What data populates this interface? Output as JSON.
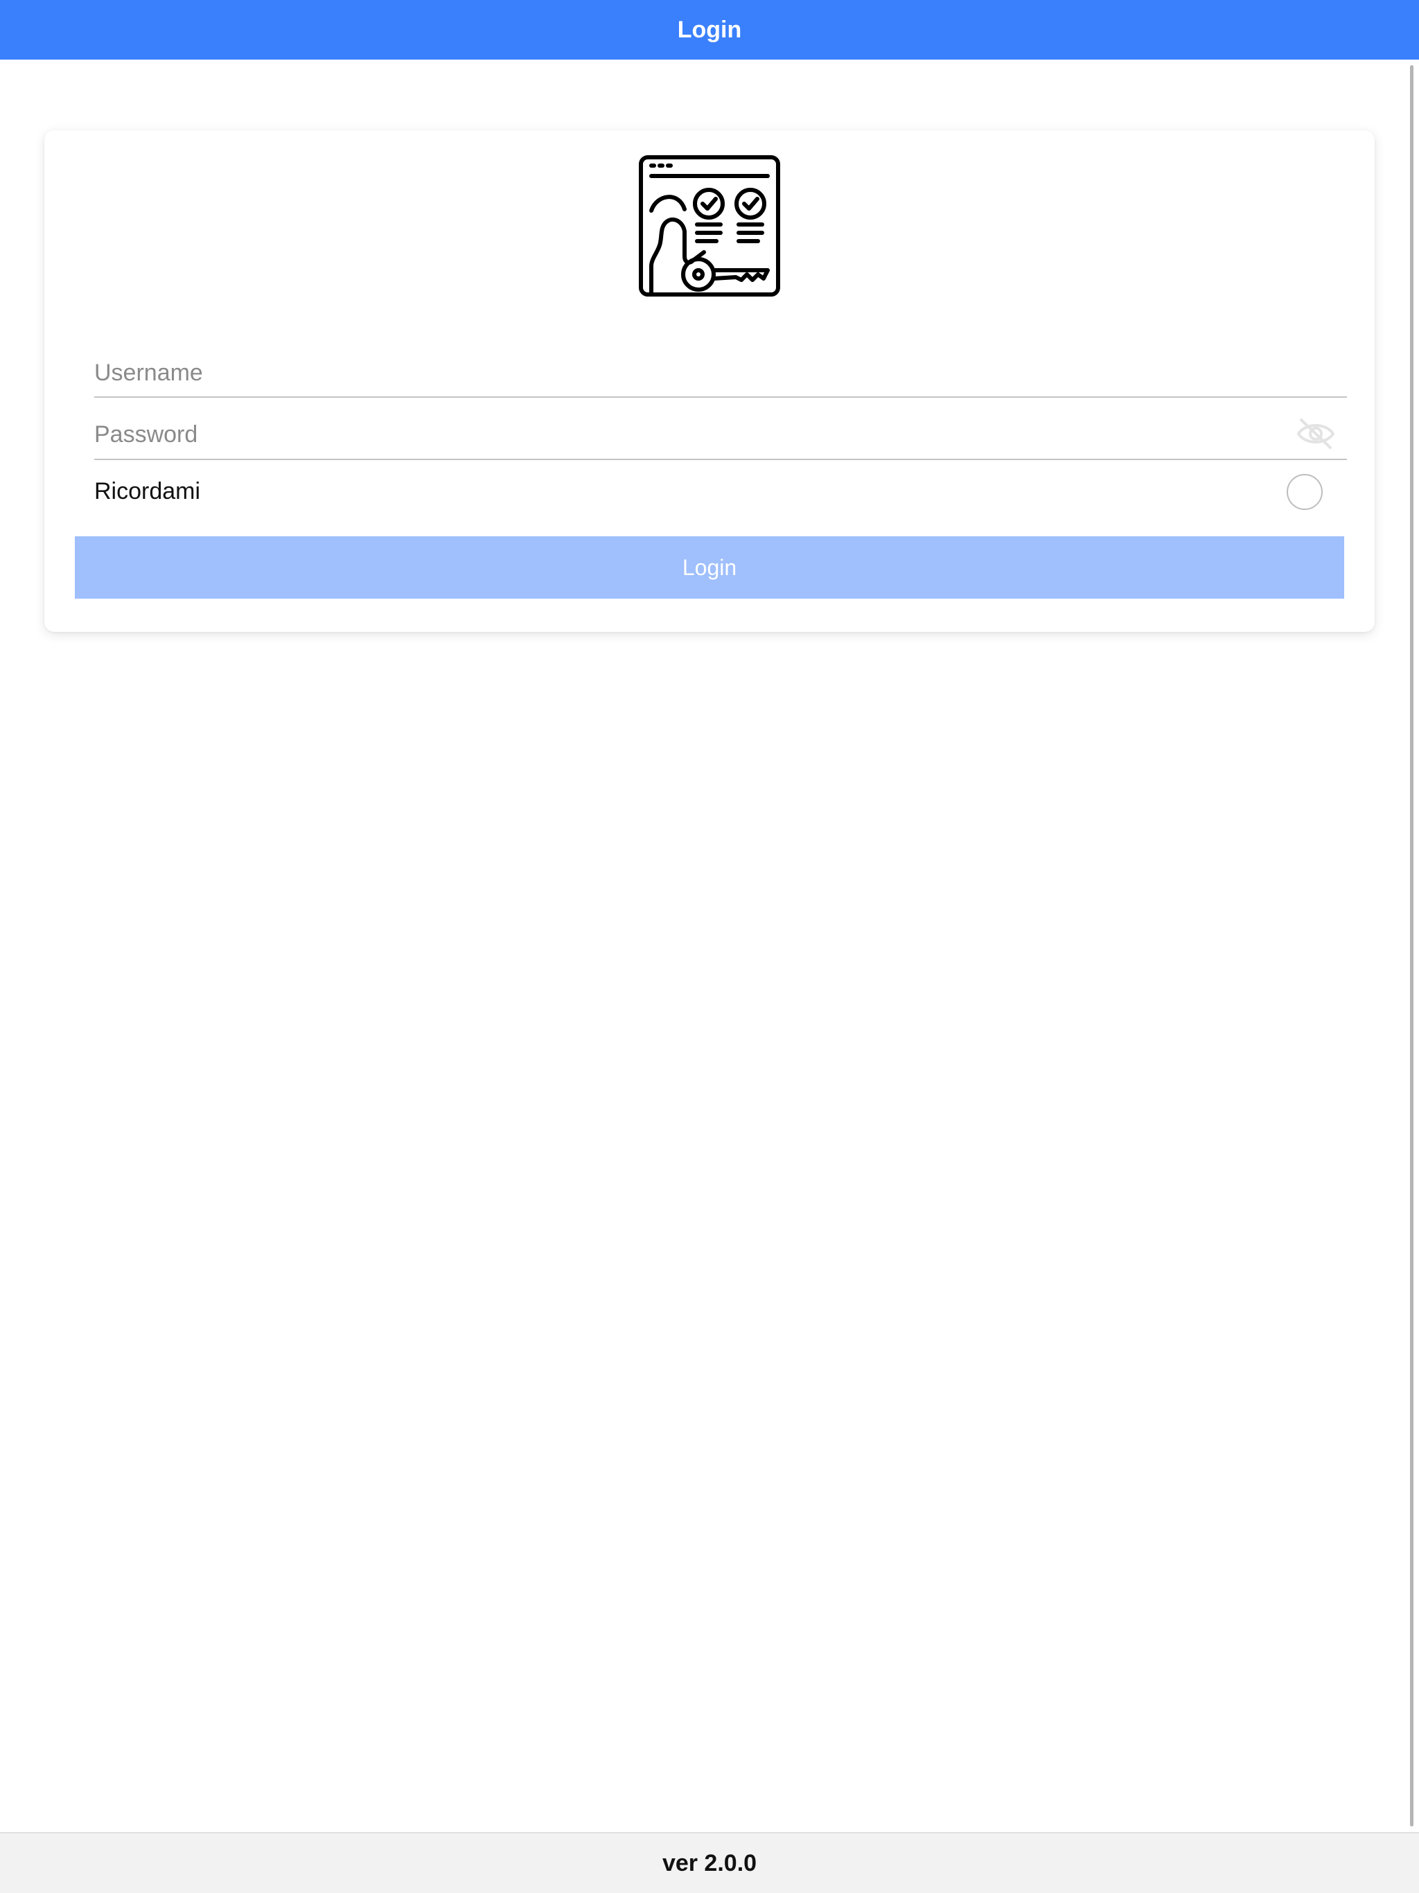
{
  "header": {
    "title": "Login"
  },
  "form": {
    "username_placeholder": "Username",
    "username_value": "",
    "password_placeholder": "Password",
    "password_value": "",
    "remember_label": "Ricordami",
    "remember_checked": false,
    "login_button_label": "Login"
  },
  "icons": {
    "logo": "identity-card-key-icon",
    "password_toggle": "eye-off-icon"
  },
  "colors": {
    "header_bg": "#3a80fd",
    "button_bg_disabled": "#9fbffd",
    "footer_bg": "#f2f2f2"
  },
  "footer": {
    "version": "ver 2.0.0"
  }
}
